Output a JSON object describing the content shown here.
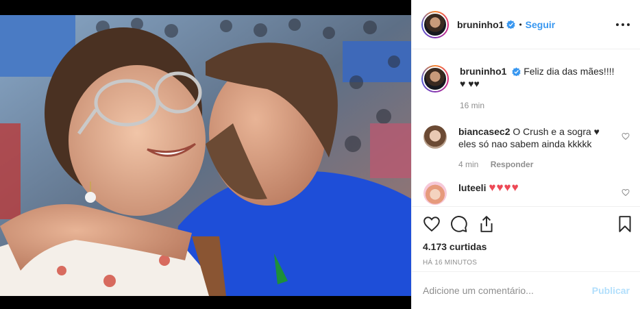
{
  "post": {
    "image_alt": "",
    "author": "bruninho1",
    "follow_label": "Seguir",
    "separator": "•",
    "caption": "Feliz dia das mães!!!! ♥ ♥♥",
    "caption_time": "16 min"
  },
  "comments": [
    {
      "user": "biancasec2",
      "text": "O Crush e a sogra ♥ eles só nao sabem ainda kkkkk",
      "time": "4 min",
      "reply_label": "Responder"
    },
    {
      "user": "luteeli",
      "text": "♥♥♥♥",
      "time": "",
      "reply_label": ""
    }
  ],
  "actions": {
    "likes": "4.173 curtidas",
    "timestamp": "HÁ 16 MINUTOS"
  },
  "composer": {
    "placeholder": "Adicione um comentário...",
    "publish_label": "Publicar"
  },
  "colors": {
    "link": "#3897f0",
    "heart_red": "#ed4956",
    "publish_disabled": "#b2dffc"
  },
  "icons": [
    "verified-badge-icon",
    "more-options-icon",
    "heart-icon",
    "comment-icon",
    "share-icon",
    "bookmark-icon"
  ]
}
